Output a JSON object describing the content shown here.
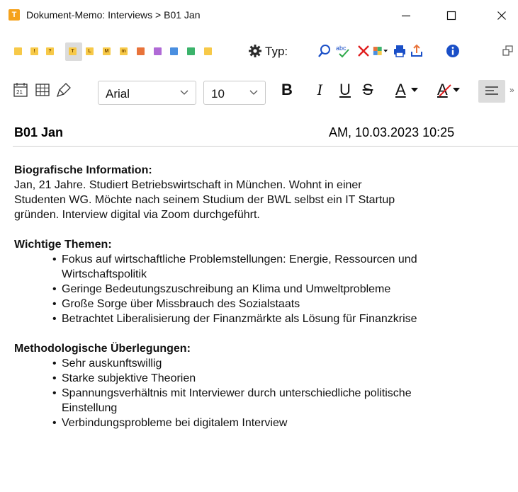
{
  "window": {
    "app_icon_letter": "T",
    "title": "Dokument-Memo: Interviews > B01 Jan"
  },
  "toolbar1": {
    "memo_icons": [
      {
        "letter": "",
        "color": "#f7c948"
      },
      {
        "letter": "!",
        "color": "#f7c948"
      },
      {
        "letter": "?",
        "color": "#f7c948"
      },
      {
        "letter": "T",
        "color": "#f7c948"
      },
      {
        "letter": "L",
        "color": "#f7c948"
      },
      {
        "letter": "M",
        "color": "#f7c948"
      },
      {
        "letter": "m",
        "color": "#f7c948"
      },
      {
        "letter": "",
        "color": "#e8733a"
      },
      {
        "letter": "",
        "color": "#b06ad6"
      },
      {
        "letter": "",
        "color": "#4a8fe0"
      },
      {
        "letter": "",
        "color": "#3bb36b"
      },
      {
        "letter": "",
        "color": "#f7c948"
      }
    ],
    "typ_label": "Typ:",
    "icons": [
      "gear-icon",
      "search-icon",
      "spellcheck-icon",
      "delete-icon",
      "color-picker-icon",
      "print-icon",
      "export-icon",
      "info-icon",
      "detach-icon"
    ]
  },
  "toolbar2": {
    "font_family": "Arial",
    "font_size": "10",
    "bold_label": "B",
    "italic_label": "I",
    "underline_label": "U",
    "strike_label": "S",
    "font_color_label": "A",
    "highlight_label": "A",
    "icons": [
      "calendar-icon",
      "table-icon",
      "paint-brush-icon"
    ]
  },
  "header": {
    "doc_name": "B01 Jan",
    "meta": "AM, 10.03.2023 10:25"
  },
  "memo": {
    "bio_heading": "Biografische Information:",
    "bio_lines": [
      "Jan, 21 Jahre. Studiert Betriebswirtschaft in München. Wohnt in einer",
      "Studenten WG. Möchte nach seinem Studium der BWL selbst ein IT Startup",
      "gründen. Interview digital via Zoom durchgeführt."
    ],
    "themes_heading": "Wichtige Themen:",
    "themes": [
      [
        "Fokus auf wirtschaftliche Problemstellungen: Energie, Ressourcen und",
        "Wirtschaftspolitik"
      ],
      [
        "Geringe Bedeutungszuschreibung an Klima und Umweltprobleme"
      ],
      [
        "Große Sorge über Missbrauch des Sozialstaats"
      ],
      [
        "Betrachtet Liberalisierung der Finanzmärkte als Lösung für Finanzkrise"
      ]
    ],
    "method_heading": "Methodologische Überlegungen:",
    "method": [
      [
        "Sehr auskunftswillig"
      ],
      [
        "Starke subjektive Theorien"
      ],
      [
        "Spannungsverhältnis mit Interviewer durch unterschiedliche politische",
        "Einstellung"
      ],
      [
        "Verbindungsprobleme bei digitalem Interview"
      ]
    ]
  }
}
